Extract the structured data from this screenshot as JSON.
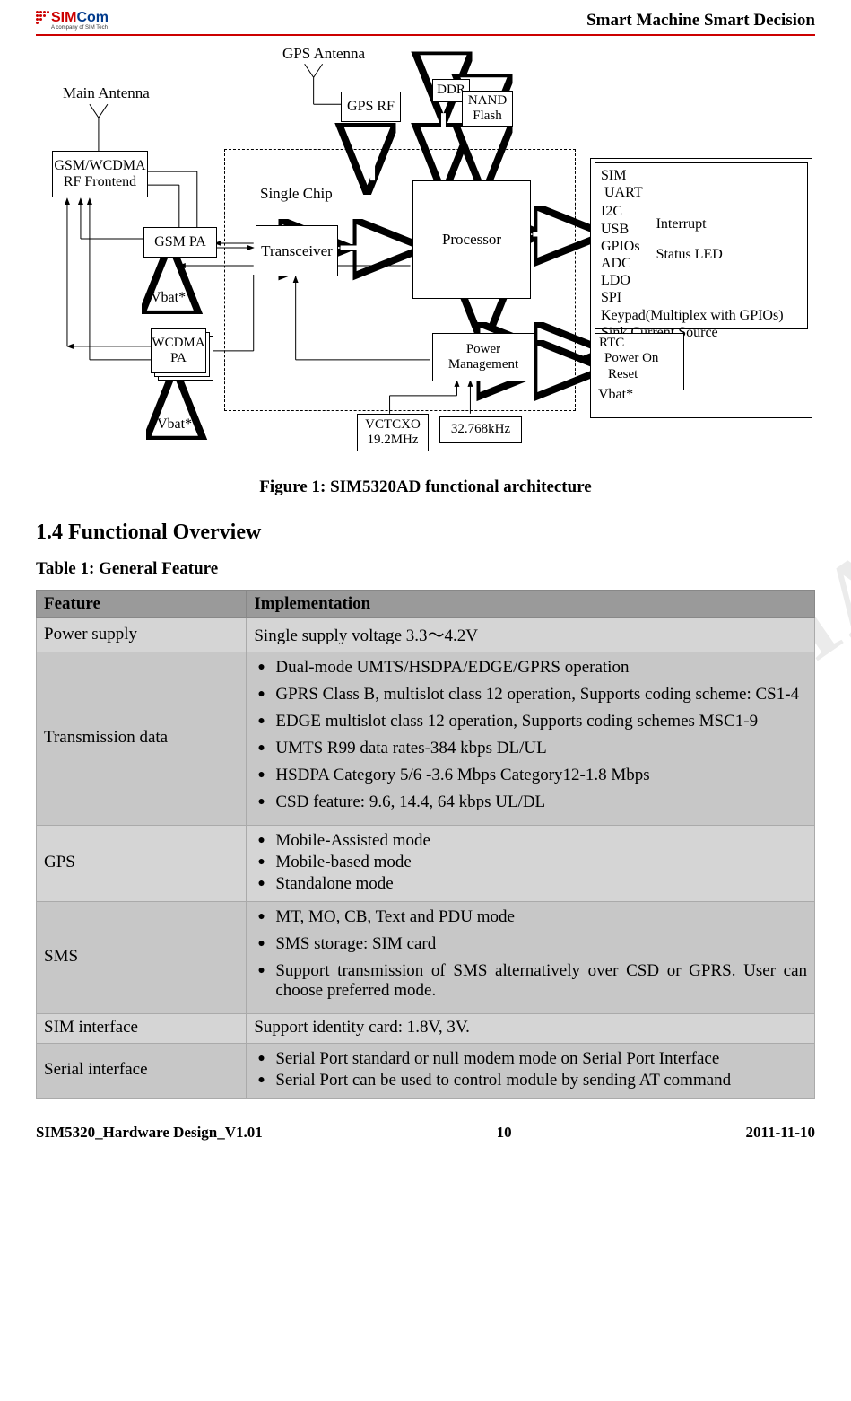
{
  "header": {
    "logo_text": "Com",
    "logo_prefix": "SIM",
    "logo_tagline": "A company of SIM Tech",
    "title": "Smart Machine Smart Decision"
  },
  "diagram": {
    "main_antenna": "Main Antenna",
    "gps_antenna": "GPS  Antenna",
    "gps_rf": "GPS RF",
    "ddr": "DDR",
    "nand_flash": "NAND\nFlash",
    "rf_frontend": "GSM/WCDMA\nRF Frontend",
    "single_chip": "Single Chip",
    "processor": "Processor",
    "transceiver": "Transceiver",
    "gsm_pa": "GSM PA",
    "wcdma_pa": "WCDMA\nPA",
    "vbat1": "Vbat*",
    "vbat2": "Vbat*",
    "vbat3": "Vbat*",
    "power_mgmt": "Power\nManagement",
    "vctcxo": "VCTCXO\n19.2MHz",
    "khz32": "32.768kHz",
    "io_list": {
      "sim": "SIM",
      "uart": "UART",
      "i2c": "I2C",
      "usb": "USB",
      "gpios": "GPIOs",
      "adc": "ADC",
      "ldo": "LDO",
      "spi": "SPI",
      "keypad": "Keypad(Multiplex with GPIOs)",
      "sink": "Sink Current Source",
      "interrupt": "Interrupt",
      "status_led": "Status LED"
    },
    "rtc_box": {
      "rtc": "RTC",
      "power_on": "Power On",
      "reset": "Reset"
    }
  },
  "figure_caption": "Figure 1: SIM5320AD functional architecture",
  "section_heading": "1.4    Functional Overview",
  "table_caption": "Table 1: General Feature",
  "table": {
    "headers": {
      "feature": "Feature",
      "impl": "Implementation"
    },
    "rows": [
      {
        "feature": "Power supply",
        "impl_text": "Single supply voltage 3.3～4.2V"
      },
      {
        "feature": "Transmission data",
        "items": [
          "Dual-mode UMTS/HSDPA/EDGE/GPRS operation",
          "GPRS Class B, multislot class 12 operation, Supports coding scheme: CS1-4",
          "EDGE multislot class 12 operation, Supports coding schemes MSC1-9",
          "UMTS R99 data rates-384 kbps DL/UL",
          "HSDPA Category 5/6 -3.6 Mbps    Category12-1.8 Mbps",
          "CSD feature: 9.6, 14.4, 64 kbps UL/DL"
        ]
      },
      {
        "feature": "GPS",
        "items": [
          "Mobile-Assisted mode",
          "Mobile-based mode",
          "Standalone mode"
        ],
        "tight": true
      },
      {
        "feature": "SMS",
        "items": [
          "MT, MO, CB, Text and PDU mode",
          "SMS storage: SIM card",
          "Support transmission of SMS alternatively over CSD or GPRS. User can choose preferred mode."
        ]
      },
      {
        "feature": "SIM interface",
        "impl_text": "Support identity card: 1.8V, 3V."
      },
      {
        "feature": "Serial interface",
        "items": [
          "Serial Port standard or null modem mode on Serial Port Interface",
          "Serial Port can be used to control module by sending AT command"
        ],
        "tight": true
      }
    ]
  },
  "footer": {
    "doc": "SIM5320_Hardware Design_V1.01",
    "page": "10",
    "date": "2011-11-10"
  },
  "watermark": "CONFIDENTIAL FILE"
}
